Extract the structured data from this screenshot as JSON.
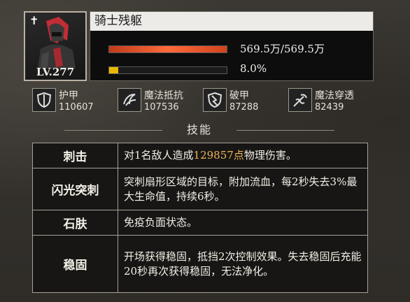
{
  "unit": {
    "name": "骑士残躯",
    "level": "LV.277",
    "hp_text": "569.5万/569.5万",
    "hp_fraction": 1.0,
    "break_text": "8.0%",
    "break_fraction": 0.08
  },
  "stats": [
    {
      "label": "护甲",
      "value": "110607",
      "icon": "shield-icon"
    },
    {
      "label": "魔法抵抗",
      "value": "107536",
      "icon": "magic-resist-icon"
    },
    {
      "label": "破甲",
      "value": "87288",
      "icon": "armor-break-icon"
    },
    {
      "label": "魔法穿透",
      "value": "82439",
      "icon": "magic-pierce-icon"
    }
  ],
  "skills_title": "技能",
  "skills": [
    {
      "name": "刺击",
      "desc_pre": "对1名敌人造成",
      "desc_hl": "129857点",
      "desc_post": "物理伤害。"
    },
    {
      "name": "闪光突刺",
      "desc_pre": "突刺扇形区域的目标，附加流血，每2秒失去3%最大生命值，持续6秒。",
      "desc_hl": "",
      "desc_post": ""
    },
    {
      "name": "石肤",
      "desc_pre": "免疫负面状态。",
      "desc_hl": "",
      "desc_post": ""
    },
    {
      "name": "稳固",
      "desc_pre": "开场获得稳固，抵挡2次控制效果。失去稳固后充能20秒再次获得稳固，无法净化。",
      "desc_hl": "",
      "desc_post": ""
    }
  ],
  "colors": {
    "highlight": "#f0b457",
    "hp_bar": "#ff6a3a",
    "break_bar": "#e6b800"
  }
}
